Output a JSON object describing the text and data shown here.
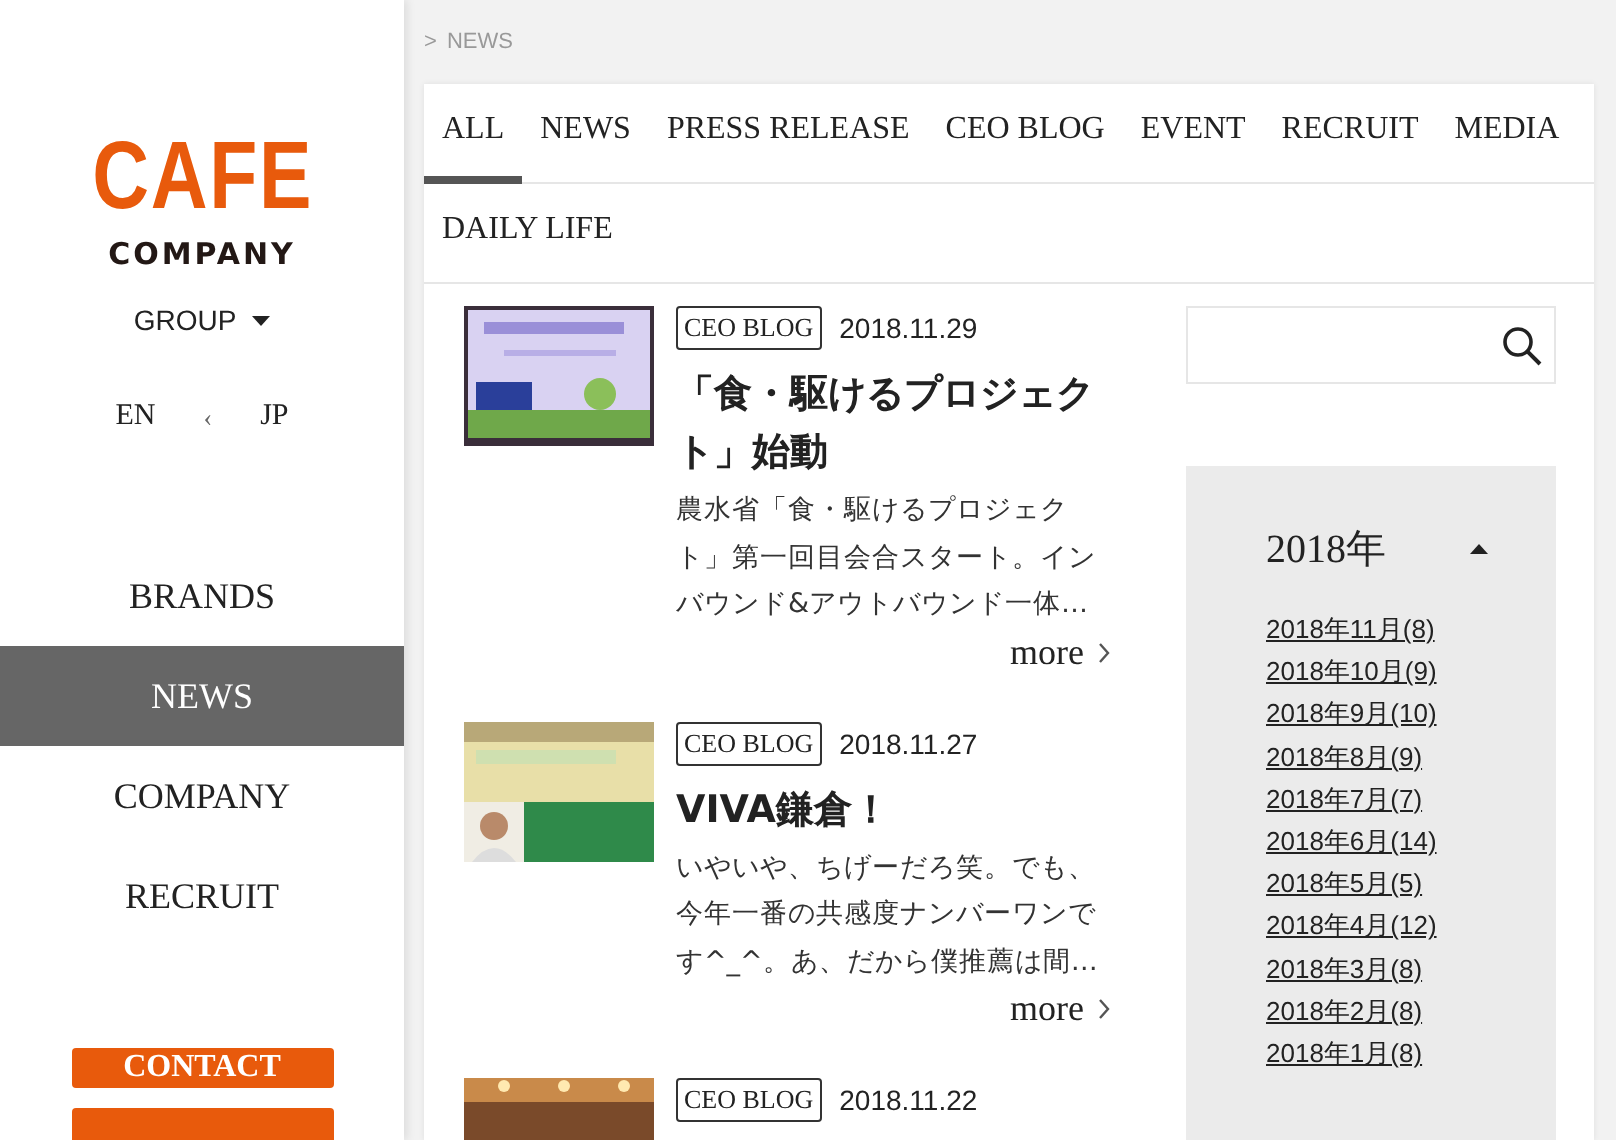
{
  "sidebar": {
    "logo": {
      "top": "CAFE",
      "bottom": "COMPANY"
    },
    "group": "GROUP",
    "languages": [
      {
        "label": "EN",
        "selected": false
      },
      {
        "label": "JP",
        "selected": false
      }
    ],
    "lang_separator": "‹",
    "nav": [
      {
        "label": "BRANDS",
        "selected": false
      },
      {
        "label": "NEWS",
        "selected": true
      },
      {
        "label": "COMPANY",
        "selected": false
      },
      {
        "label": "RECRUIT",
        "selected": false
      }
    ],
    "contact": "CONTACT"
  },
  "breadcrumb": {
    "separator": ">",
    "current": "NEWS"
  },
  "tabs": [
    {
      "label": "ALL",
      "selected": true
    },
    {
      "label": "NEWS",
      "selected": false
    },
    {
      "label": "PRESS RELEASE",
      "selected": false
    },
    {
      "label": "CEO BLOG",
      "selected": false
    },
    {
      "label": "EVENT",
      "selected": false
    },
    {
      "label": "RECRUIT",
      "selected": false
    },
    {
      "label": "MEDIA",
      "selected": false
    },
    {
      "label": "DAILY LIFE",
      "selected": false
    }
  ],
  "articles": [
    {
      "tag": "CEO BLOG",
      "date": "2018.11.29",
      "title": "「食・駆けるプロジェクト」始動",
      "excerpt": "農水省「食・駆けるプロジェクト」第一回目会合スタート。インバウンド&アウトバウンド一体…",
      "more": "more"
    },
    {
      "tag": "CEO BLOG",
      "date": "2018.11.27",
      "title": "VIVA鎌倉！",
      "excerpt": "いやいや、ちげーだろ笑。でも、今年一番の共感度ナンバーワンです^_^。あ、だから僕推薦は間…",
      "more": "more"
    },
    {
      "tag": "CEO BLOG",
      "date": "2018.11.22"
    }
  ],
  "archive": {
    "year": "2018年",
    "expanded": true,
    "months": [
      "2018年11月(8)",
      "2018年10月(9)",
      "2018年9月(10)",
      "2018年8月(9)",
      "2018年7月(7)",
      "2018年6月(14)",
      "2018年5月(5)",
      "2018年4月(12)",
      "2018年3月(8)",
      "2018年2月(8)",
      "2018年1月(8)"
    ]
  }
}
